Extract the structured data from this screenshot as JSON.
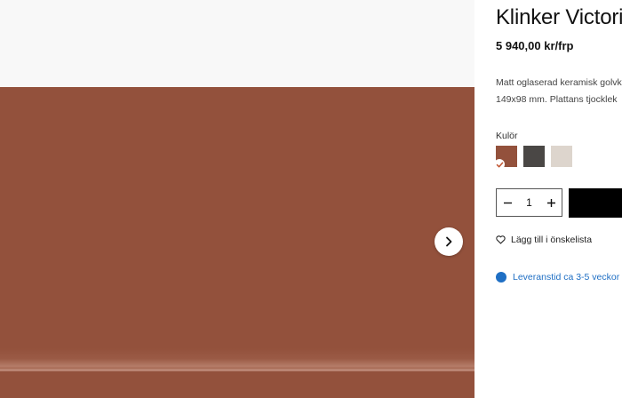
{
  "product": {
    "title": "Klinker Victoria",
    "price": "5 940,00 kr/frp",
    "description_lines": [
      "Matt oglaserad keramisk golvklinker",
      "149x98 mm. Plattans tjocklek"
    ]
  },
  "colors": {
    "label": "Kulör",
    "swatches": [
      {
        "color": "#93513c",
        "selected": true
      },
      {
        "color": "#4a4745",
        "selected": false
      },
      {
        "color": "#ddd5cd",
        "selected": false
      }
    ]
  },
  "quantity": {
    "value": "1",
    "minus_icon": "minus-icon",
    "plus_icon": "plus-icon"
  },
  "wishlist": {
    "label": "Lägg till i önskelista",
    "icon": "heart-icon"
  },
  "delivery": {
    "label": "Leveranstid ca 3-5 veckor",
    "color": "#1f6fc4"
  },
  "gallery": {
    "next_icon": "chevron-right-icon"
  }
}
